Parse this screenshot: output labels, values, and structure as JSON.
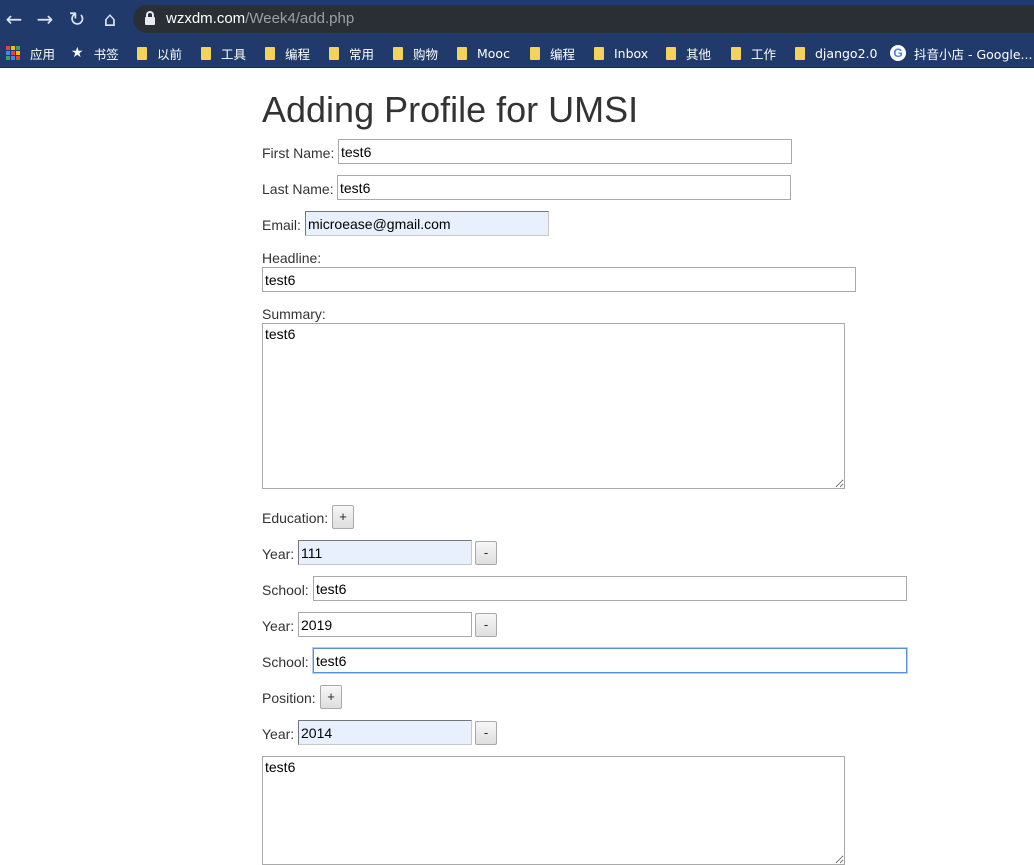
{
  "browser": {
    "url_host": "wzxdm.com",
    "url_path": "/Week4/add.php",
    "bookmarks": [
      {
        "label": "应用",
        "icon": "apps-grid-icon"
      },
      {
        "label": "书签",
        "icon": "star-icon"
      },
      {
        "label": "以前",
        "icon": "folder-icon"
      },
      {
        "label": "工具",
        "icon": "folder-icon"
      },
      {
        "label": "编程",
        "icon": "folder-icon"
      },
      {
        "label": "常用",
        "icon": "folder-icon"
      },
      {
        "label": "购物",
        "icon": "folder-icon"
      },
      {
        "label": "Mooc",
        "icon": "folder-icon"
      },
      {
        "label": "编程",
        "icon": "folder-icon"
      },
      {
        "label": "Inbox",
        "icon": "folder-icon"
      },
      {
        "label": "其他",
        "icon": "folder-icon"
      },
      {
        "label": "工作",
        "icon": "folder-icon"
      },
      {
        "label": "django2.0",
        "icon": "folder-icon"
      },
      {
        "label": "抖音小店 - Google...",
        "icon": "google-icon"
      }
    ]
  },
  "form": {
    "title": "Adding Profile for UMSI",
    "first_name_label": "First Name:",
    "first_name": "test6",
    "last_name_label": "Last Name:",
    "last_name": "test6",
    "email_label": "Email:",
    "email": "microease@gmail.com",
    "headline_label": "Headline:",
    "headline": "test6",
    "summary_label": "Summary:",
    "summary": "test6",
    "education_label": "Education:",
    "add_label": "+",
    "remove_label": "-",
    "year_label": "Year:",
    "school_label": "School:",
    "education": [
      {
        "year": "111",
        "school": "test6"
      },
      {
        "year": "2019",
        "school": "test6"
      }
    ],
    "position_label": "Position:",
    "position": {
      "year": "2014",
      "description": "test6"
    }
  },
  "colors": {
    "chrome": "#1f3a6b",
    "omnibox": "#2a2f36",
    "autofill": "#e8f0fe",
    "focus": "#5b8fd8"
  }
}
